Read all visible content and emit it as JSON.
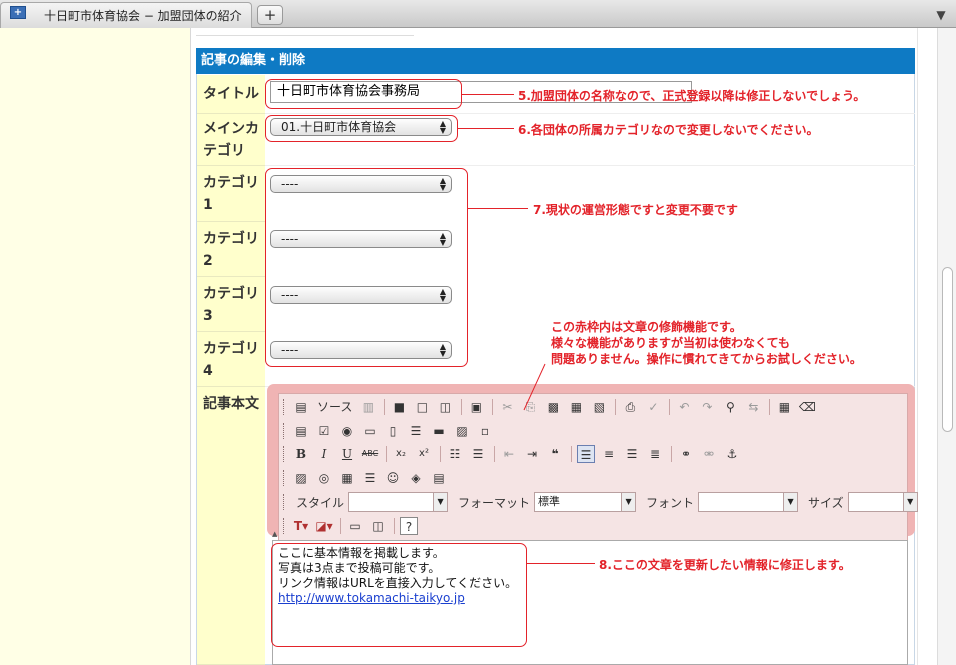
{
  "browser": {
    "tab_title": "十日町市体育協会 − 加盟団体の紹介",
    "new_tab_label": "+",
    "tab_menu_label": "▼"
  },
  "form": {
    "header": "記事の編集・削除",
    "title_label": "タイトル",
    "title_value": "十日町市体育協会事務局",
    "main_category_label": "メインカテゴリ",
    "main_category_value": "01.十日町市体育協会",
    "categories": [
      {
        "label": "カテゴリ1",
        "value": "----"
      },
      {
        "label": "カテゴリ2",
        "value": "----"
      },
      {
        "label": "カテゴリ3",
        "value": "----"
      },
      {
        "label": "カテゴリ4",
        "value": "----"
      }
    ],
    "body_label": "記事本文"
  },
  "toolbar": {
    "source_label": "ソース",
    "style_label": "スタイル",
    "style_value": "",
    "format_label": "フォーマット",
    "format_value": "標準",
    "font_label": "フォント",
    "font_value": "",
    "size_label": "サイズ",
    "size_value": ""
  },
  "editor": {
    "lines": [
      "ここに基本情報を掲載します。",
      "写真は3点まで投稿可能です。",
      "リンク情報はURLを直接入力してください。"
    ],
    "link": "http://www.tokamachi-taikyo.jp"
  },
  "annotations": {
    "a5": "5.加盟団体の名称なので、正式登録以降は修正しないでしょう。",
    "a6": "6.各団体の所属カテゴリなので変更しないでください。",
    "a7": "7.現状の運営形態ですと変更不要です",
    "toolbar_note": [
      "この赤枠内は文章の修飾機能です。",
      "様々な機能がありますが当初は使わなくても",
      "問題ありません。操作に慣れてきてからお試しください。"
    ],
    "a8": "8.ここの文章を更新したい情報に修正します。"
  },
  "colors": {
    "header_blue": "#0e7ac4",
    "label_yellow": "#ffffcc",
    "annotation_red": "#e3232a",
    "toolbar_pink": "#f0b4b4"
  }
}
